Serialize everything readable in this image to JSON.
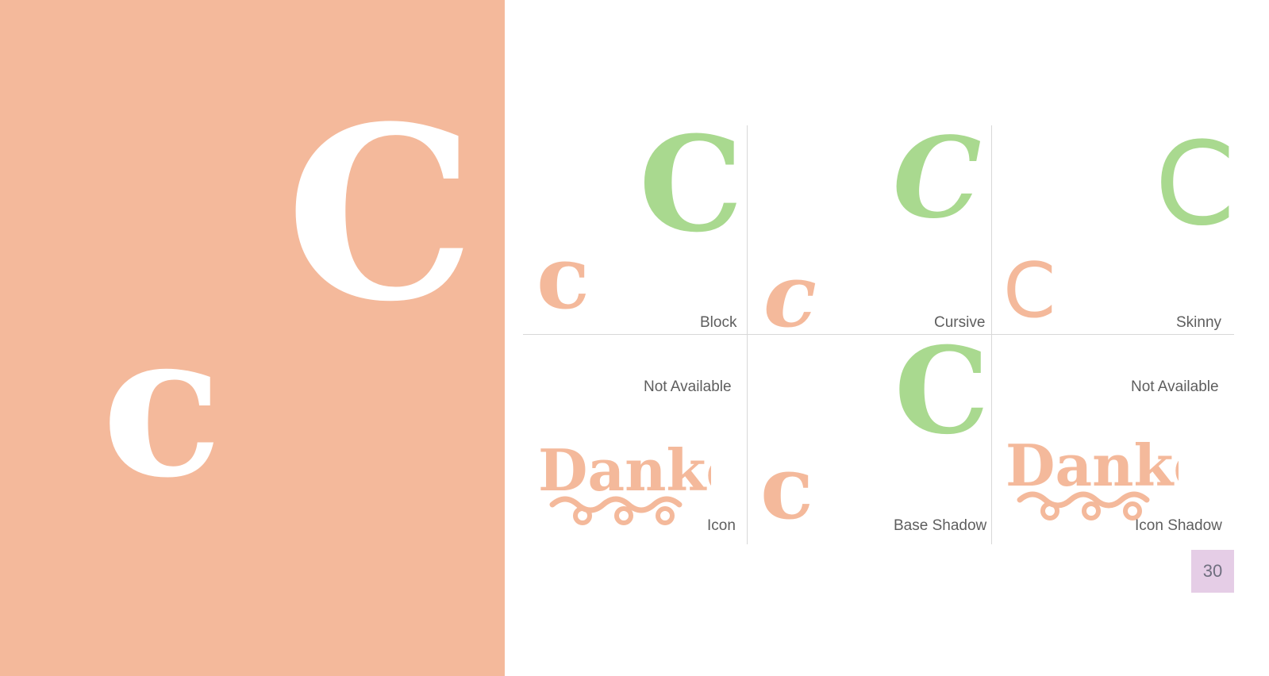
{
  "hero": {
    "upper": "C",
    "lower": "c"
  },
  "cells": [
    {
      "label": "Block",
      "upper": "C",
      "lower": "c"
    },
    {
      "label": "Cursive",
      "upper": "C",
      "lower": "c"
    },
    {
      "label": "Skinny",
      "upper": "C",
      "lower": "C"
    },
    {
      "label": "Icon",
      "status": "Not Available",
      "art": "Danke!"
    },
    {
      "label": "Base Shadow",
      "upper": "C",
      "lower": "c"
    },
    {
      "label": "Icon Shadow",
      "status": "Not Available",
      "art": "Danke!"
    }
  ],
  "page": {
    "number": "30"
  },
  "colors": {
    "peach": "#f4b99b",
    "green": "#a9d98f",
    "badge": "#e5cde6"
  }
}
